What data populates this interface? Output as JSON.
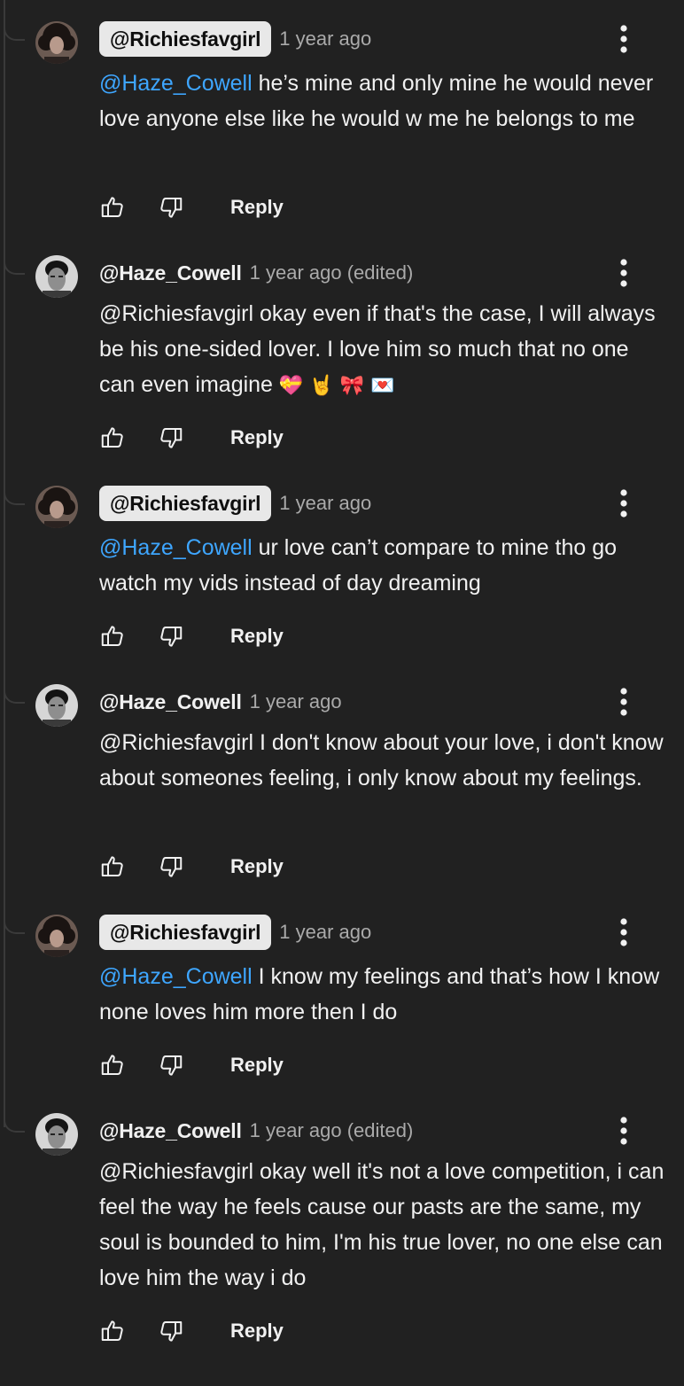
{
  "icons": {
    "like": "thumb-up-outline-icon",
    "dislike": "thumb-down-outline-icon",
    "more": "three-dots-vertical-icon"
  },
  "colors": {
    "background": "#212121",
    "mention": "#3ea6ff",
    "owner_chip": "#e8e8e8",
    "muted_text": "#aaaaaa"
  },
  "comments": [
    {
      "author": "@Richiesfavgirl",
      "author_chip": true,
      "time": "1 year ago",
      "mention": "@Haze_Cowell",
      "body": " he’s mine and only mine he would never love anyone else like he would w me he belongs to me",
      "reply_label": "Reply"
    },
    {
      "author": "@Haze_Cowell",
      "author_chip": false,
      "time": "1 year ago (edited)",
      "body": "@Richiesfavgirl okay even if that's the case, I will always be his one-sided lover. I love him so much that no one can even imagine",
      "emojis": "💝 🤘 🎀 💌",
      "reply_label": "Reply"
    },
    {
      "author": "@Richiesfavgirl",
      "author_chip": true,
      "time": "1 year ago",
      "mention": "@Haze_Cowell",
      "body": " ur love can’t compare to mine tho go watch my vids instead of day dreaming",
      "reply_label": "Reply"
    },
    {
      "author": "@Haze_Cowell",
      "author_chip": false,
      "time": "1 year ago",
      "body": "@Richiesfavgirl I don't know about your love, i don't know about someones feeling, i only know about my feelings.",
      "reply_label": "Reply"
    },
    {
      "author": "@Richiesfavgirl",
      "author_chip": true,
      "time": "1 year ago",
      "mention": "@Haze_Cowell",
      "body": " I know my feelings and that’s how I know none loves him more then I do",
      "reply_label": "Reply"
    },
    {
      "author": "@Haze_Cowell",
      "author_chip": false,
      "time": "1 year ago (edited)",
      "body": "@Richiesfavgirl okay well it's not a love competition, i can feel the way he feels cause our pasts are the same, my soul is bounded to him, I'm his true lover, no one else can love him the way i do",
      "reply_label": "Reply"
    }
  ]
}
